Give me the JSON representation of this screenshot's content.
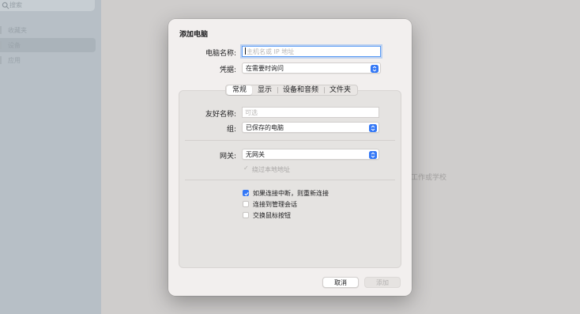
{
  "background": {
    "sidebar": {
      "search_placeholder": "搜索",
      "items": [
        {
          "label": "收藏夹"
        },
        {
          "label": "设备"
        },
        {
          "label": "应用"
        }
      ]
    },
    "main_hint": "工作或学校"
  },
  "dialog": {
    "title": "添加电脑",
    "pc_name": {
      "label": "电脑名称:",
      "placeholder": "主机名或 IP 地址",
      "value": ""
    },
    "credentials": {
      "label": "凭据:",
      "selected": "在需要时询问"
    },
    "tabs": [
      {
        "label": "常规",
        "active": true
      },
      {
        "label": "显示",
        "active": false
      },
      {
        "label": "设备和音频",
        "active": false
      },
      {
        "label": "文件夹",
        "active": false
      }
    ],
    "general": {
      "friendly_name": {
        "label": "友好名称:",
        "placeholder": "可选",
        "value": ""
      },
      "group": {
        "label": "组:",
        "selected": "已保存的电脑"
      },
      "gateway": {
        "label": "网关:",
        "selected": "无网关"
      },
      "bypass_local": {
        "label": "绕过本地地址",
        "checked": true,
        "enabled": false
      },
      "reconnect": {
        "label": "如果连接中断，则重新连接",
        "checked": true
      },
      "admin_session": {
        "label": "连接到管理会话",
        "checked": false
      },
      "swap_mouse": {
        "label": "交换鼠标按钮",
        "checked": false
      }
    },
    "buttons": {
      "cancel": "取消",
      "add": "添加"
    }
  },
  "colors": {
    "accent": "#3478f6",
    "focus_ring": "#5c9cf4",
    "dialog_bg": "#f2efee",
    "panel_bg": "#e5e3e1",
    "sidebar_bg": "#b7bfc6",
    "window_bg": "#cfcdcc"
  }
}
